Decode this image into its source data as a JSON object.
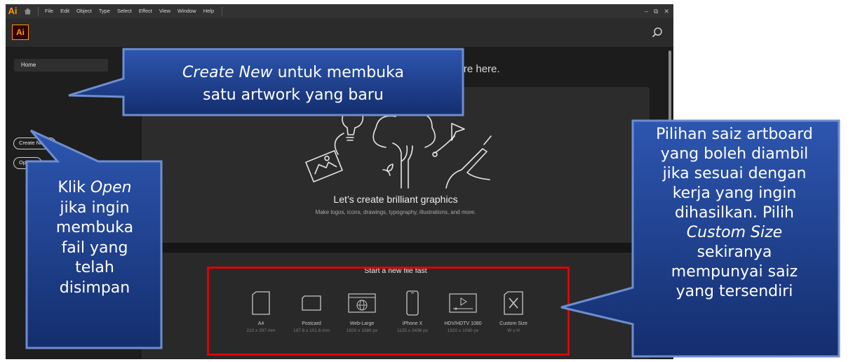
{
  "menu": {
    "app_mark": "Ai",
    "items": [
      "File",
      "Edit",
      "Object",
      "Type",
      "Select",
      "Effect",
      "View",
      "Window",
      "Help"
    ]
  },
  "window_controls": {
    "minimize": "–",
    "restore": "⧉",
    "close": "✕"
  },
  "header": {
    "logo": "Ai"
  },
  "sidebar": {
    "home": "Home",
    "create_new": "Create New...",
    "open": "Open..."
  },
  "main": {
    "welcome_fragment": "'re here.",
    "hero_title": "Let’s create brilliant graphics",
    "hero_subtitle": "Make logos, icons, drawings, typography, illustrations, and more.",
    "quick_title": "Start a new file fast",
    "presets": [
      {
        "name": "A4",
        "size": "210 x 297 mm",
        "icon": "document-portrait-icon"
      },
      {
        "name": "Postcard",
        "size": "197.6 x 101.6 mm",
        "icon": "postcard-icon"
      },
      {
        "name": "Web-Large",
        "size": "1920 x 1080 px",
        "icon": "web-globe-icon"
      },
      {
        "name": "iPhone X",
        "size": "1125 x 2436 px",
        "icon": "phone-icon"
      },
      {
        "name": "HDV/HDTV 1080",
        "size": "1920 x 1080 px",
        "icon": "video-play-icon"
      },
      {
        "name": "Custom Size",
        "size": "W x H",
        "icon": "custom-size-icon"
      }
    ]
  },
  "callouts": {
    "create_new": {
      "italic": "Create New",
      "rest_line1": " untuk membuka",
      "line2": "satu artwork yang baru"
    },
    "open": {
      "line1_pre": "Klik ",
      "line1_italic": "Open",
      "line2": "jika ingin",
      "line3": "membuka",
      "line4": "fail yang",
      "line5": "telah",
      "line6": "disimpan"
    },
    "artboard": {
      "line1": "Pilihan saiz artboard",
      "line2": "yang boleh diambil",
      "line3": "jika sesuai dengan",
      "line4": "kerja yang ingin",
      "line5": "dihasilkan. Pilih",
      "line6_italic": "Custom Size",
      "line7": "sekiranya",
      "line8": "mempunyai saiz",
      "line9": "yang tersendiri"
    }
  },
  "colors": {
    "brand_orange": "#ff9a00",
    "highlight_red": "#e00000",
    "callout_fill": "#1b3c88",
    "callout_edge": "#6e8ed0"
  }
}
